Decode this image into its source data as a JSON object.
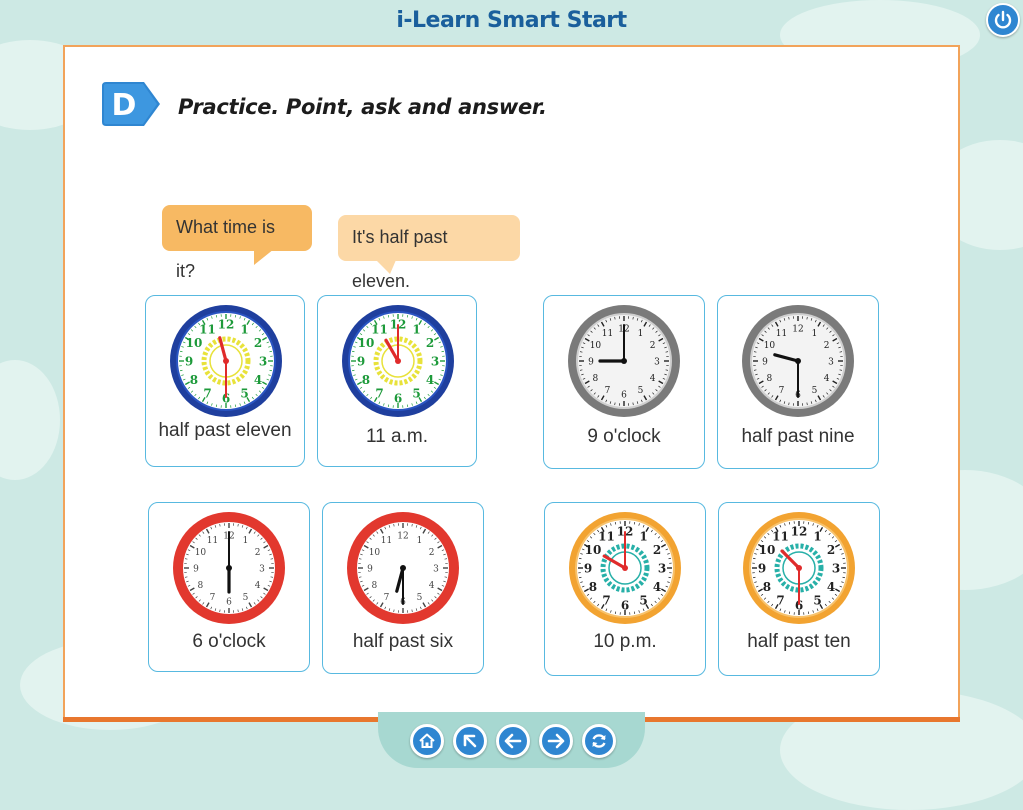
{
  "app": {
    "title": "i-Learn Smart Start"
  },
  "exercise": {
    "badge_letter": "D",
    "instruction": "Practice. Point, ask and answer."
  },
  "dialogue": {
    "question": "What time is it?",
    "answer": "It's half past eleven."
  },
  "clock_cards": [
    {
      "label": "half past eleven",
      "style": "blue-green-numbers",
      "hour": 11,
      "minute": 30
    },
    {
      "label": "11 a.m.",
      "style": "blue-green-numbers",
      "hour": 11,
      "minute": 0
    },
    {
      "label": "9 o'clock",
      "style": "silver",
      "hour": 9,
      "minute": 0
    },
    {
      "label": "half past nine",
      "style": "silver",
      "hour": 9,
      "minute": 30
    },
    {
      "label": "6 o'clock",
      "style": "red",
      "hour": 6,
      "minute": 0
    },
    {
      "label": "half past six",
      "style": "red",
      "hour": 6,
      "minute": 30
    },
    {
      "label": "10 p.m.",
      "style": "orange-teal",
      "hour": 10,
      "minute": 0
    },
    {
      "label": "half past ten",
      "style": "orange-teal",
      "hour": 10,
      "minute": 30
    }
  ],
  "navigation": {
    "icons": [
      "home-icon",
      "back-to-top-icon",
      "previous-icon",
      "next-icon",
      "refresh-icon"
    ]
  },
  "colors": {
    "title": "#1a5f9c",
    "accent_blue": "#2f86d1",
    "page_border": "#f2a35a",
    "card_border": "#58b9e0",
    "background": "#cde9e4"
  }
}
